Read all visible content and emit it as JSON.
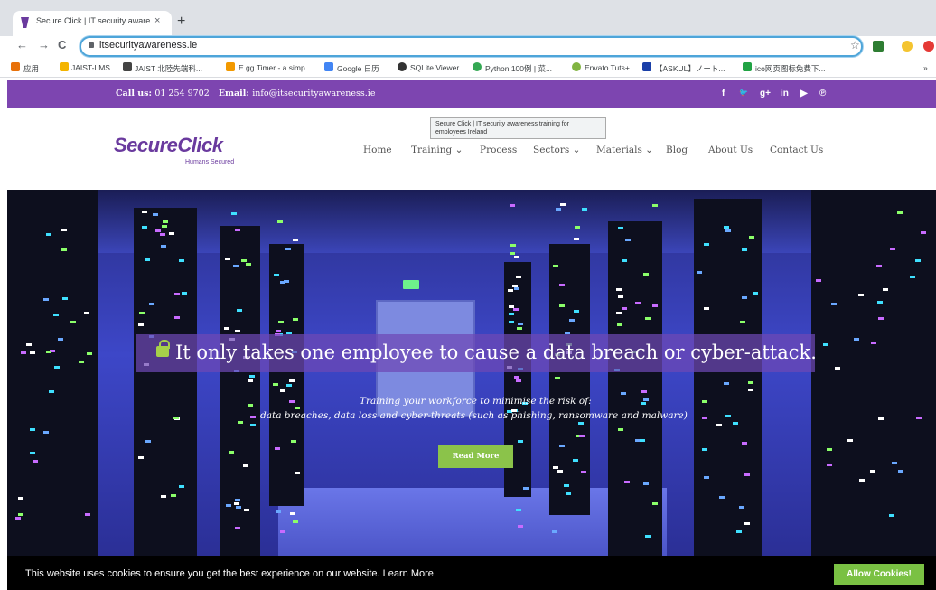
{
  "browser": {
    "tab_title": "Secure Click | IT security aware",
    "tab_close": "×",
    "new_tab": "+",
    "url": "itsecurityawareness.ie",
    "back": "←",
    "forward": "→",
    "reload": "C",
    "star": "☆",
    "menu_more": "»",
    "bookmarks": [
      {
        "label": "应用",
        "color": "#e8710a"
      },
      {
        "label": "JAIST-LMS",
        "color": "#f4b400"
      },
      {
        "label": "JAIST 北陸先端科...",
        "color": "#444444"
      },
      {
        "label": "E.gg Timer - a simp...",
        "color": "#f29900"
      },
      {
        "label": "Google 日历",
        "color": "#4285f4"
      },
      {
        "label": "SQLite Viewer",
        "color": "#333333"
      },
      {
        "label": "Python 100例 | 菜...",
        "color": "#34a853"
      },
      {
        "label": "Envato Tuts+",
        "color": "#81b441"
      },
      {
        "label": "【ASKUL】ノート...",
        "color": "#1a3fa8"
      },
      {
        "label": "ico网页图标免费下...",
        "color": "#21a344"
      }
    ]
  },
  "topbar": {
    "call_label": "Call us:",
    "phone": "01 254 9702",
    "email_label": "Email:",
    "email": "info@itsecurityawareness.ie",
    "social": [
      "f",
      "🐦",
      "g+",
      "in",
      "▶",
      "℗"
    ]
  },
  "header": {
    "logo": "SecureClick",
    "tagline": "Humans Secured",
    "tooltip": "Secure Click | IT security awareness training for employees Ireland",
    "nav": [
      {
        "label": "Home"
      },
      {
        "label": "Training ⌄"
      },
      {
        "label": "Process"
      },
      {
        "label": "Sectors ⌄"
      },
      {
        "label": "Materials ⌄"
      },
      {
        "label": "Blog"
      },
      {
        "label": "About Us"
      },
      {
        "label": "Contact Us"
      }
    ]
  },
  "hero": {
    "headline": "It only takes one employee to cause a data breach or cyber-attack.",
    "sub1": "Training your workforce to minimise the risk of:",
    "sub2": "data breaches, data loss and cyber-threats (such as phishing, ransomware and malware)",
    "button": "Read More"
  },
  "cookie": {
    "text": "This website uses cookies to ensure you get the best experience on our website.",
    "learn_more": "Learn More",
    "allow": "Allow Cookies!"
  },
  "colors": {
    "brand_purple": "#7d45b0",
    "accent_green": "#8bc34a"
  }
}
